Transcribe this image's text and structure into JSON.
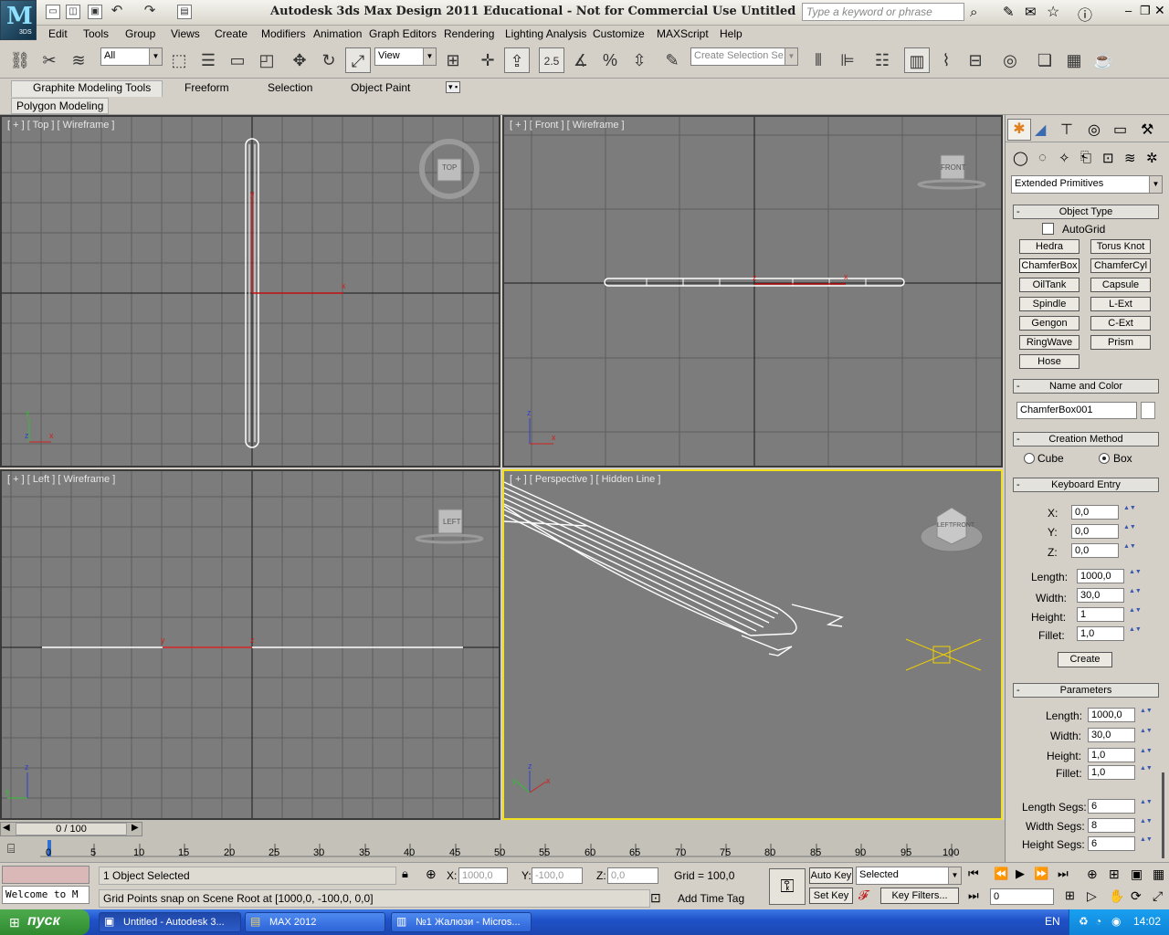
{
  "app": {
    "title": "Autodesk 3ds Max Design 2011    Educational - Not for Commercial Use    Untitled",
    "logo_text": "3DS",
    "search_placeholder": "Type a keyword or phrase"
  },
  "menu": [
    "Edit",
    "Tools",
    "Group",
    "Views",
    "Create",
    "Modifiers",
    "Animation",
    "Graph Editors",
    "Rendering",
    "Lighting Analysis",
    "Customize",
    "MAXScript",
    "Help"
  ],
  "toolbar": {
    "selection_filter": "All",
    "ref_coord": "View",
    "snap_label": "2.5",
    "named_selection_placeholder": "Create Selection Se"
  },
  "ribbon": {
    "tabs": [
      "Graphite Modeling Tools",
      "Freeform",
      "Selection",
      "Object Paint"
    ],
    "panel": "Polygon Modeling"
  },
  "viewports": {
    "top": {
      "label": "[ + ] [ Top ] [ Wireframe ]",
      "cube": "TOP"
    },
    "front": {
      "label": "[ + ] [ Front ] [ Wireframe ]",
      "cube": "FRONT"
    },
    "left": {
      "label": "[ + ] [ Left ] [ Wireframe ]",
      "cube": "LEFT"
    },
    "perspective": {
      "label": "[ + ] [ Perspective ] [ Hidden Line ]",
      "cube_a": "LEFT",
      "cube_b": "FRONT"
    }
  },
  "axes": {
    "x": "x",
    "y": "y",
    "z": "z"
  },
  "command_panel": {
    "category": "Extended Primitives",
    "object_type": {
      "header": "Object Type",
      "autogrid": "AutoGrid",
      "buttons": [
        "Hedra",
        "Torus Knot",
        "ChamferBox",
        "ChamferCyl",
        "OilTank",
        "Capsule",
        "Spindle",
        "L-Ext",
        "Gengon",
        "C-Ext",
        "RingWave",
        "Prism",
        "Hose"
      ],
      "active": "ChamferBox"
    },
    "name_color": {
      "header": "Name and Color",
      "name": "ChamferBox001"
    },
    "creation_method": {
      "header": "Creation Method",
      "options": [
        "Cube",
        "Box"
      ],
      "selected": "Box"
    },
    "keyboard_entry": {
      "header": "Keyboard Entry",
      "x_label": "X:",
      "x": "0,0",
      "y_label": "Y:",
      "y": "0,0",
      "z_label": "Z:",
      "z": "0,0",
      "length_label": "Length:",
      "length": "1000,0",
      "width_label": "Width:",
      "width": "30,0",
      "height_label": "Height:",
      "height": "1",
      "fillet_label": "Fillet:",
      "fillet": "1,0",
      "create": "Create"
    },
    "parameters": {
      "header": "Parameters",
      "length_label": "Length:",
      "length": "1000,0",
      "width_label": "Width:",
      "width": "30,0",
      "height_label": "Height:",
      "height": "1,0",
      "fillet_label": "Fillet:",
      "fillet": "1,0",
      "length_segs_label": "Length Segs:",
      "length_segs": "6",
      "width_segs_label": "Width Segs:",
      "width_segs": "8",
      "height_segs_label": "Height Segs:",
      "height_segs": "6"
    }
  },
  "timeline": {
    "frame": "0 / 100",
    "ticks": [
      "0",
      "5",
      "10",
      "15",
      "20",
      "25",
      "30",
      "35",
      "40",
      "45",
      "50",
      "55",
      "60",
      "65",
      "70",
      "75",
      "80",
      "85",
      "90",
      "95",
      "100"
    ]
  },
  "status": {
    "selected": "1 Object Selected",
    "prompt": "Grid Points snap on Scene Root at [1000,0, -100,0, 0,0]",
    "welcome": "Welcome to M",
    "x_label": "X:",
    "x": "1000,0",
    "y_label": "Y:",
    "y": "-100,0",
    "z_label": "Z:",
    "z": "0,0",
    "grid": "Grid = 100,0",
    "add_time_tag": "Add Time Tag",
    "auto_key": "Auto Key",
    "set_key": "Set Key",
    "key_mode": "Selected",
    "key_filters": "Key Filters...",
    "frame_field": "0"
  },
  "taskbar": {
    "start": "пуск",
    "items": [
      "Untitled - Autodesk 3...",
      "MAX 2012",
      "№1 Жалюзи - Micros..."
    ],
    "lang": "EN",
    "clock": "14:02"
  }
}
